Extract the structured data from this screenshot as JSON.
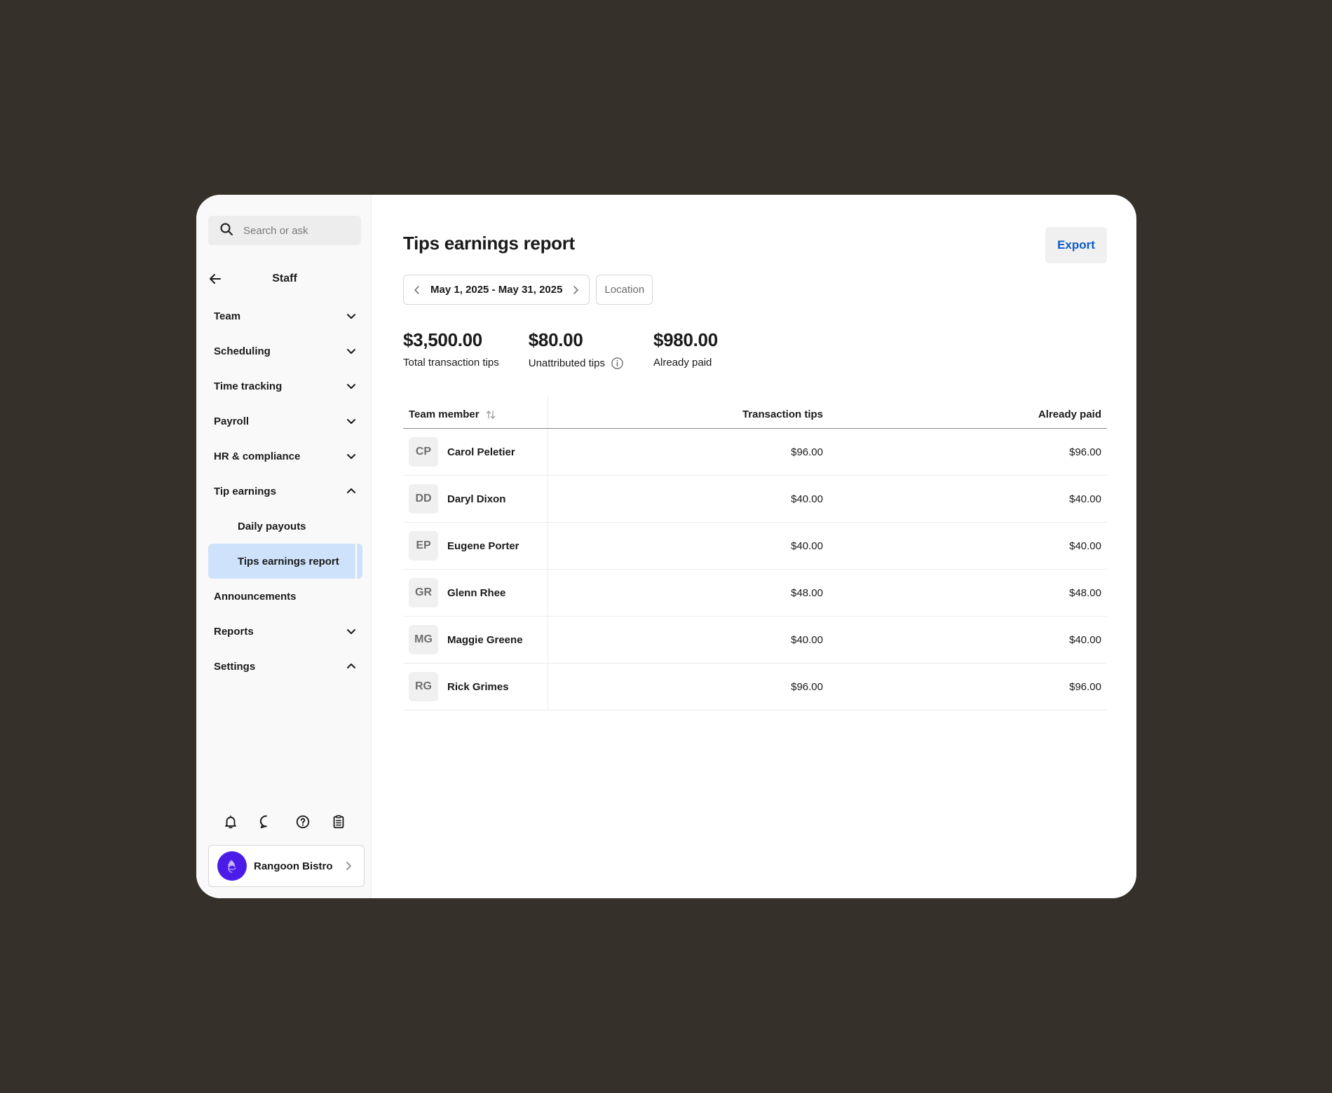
{
  "search": {
    "placeholder": "Search or ask"
  },
  "sidebar": {
    "title": "Staff",
    "items": [
      {
        "label": "Team",
        "chevron": "down"
      },
      {
        "label": "Scheduling",
        "chevron": "down"
      },
      {
        "label": "Time tracking",
        "chevron": "down"
      },
      {
        "label": "Payroll",
        "chevron": "down"
      },
      {
        "label": "HR & compliance",
        "chevron": "down"
      },
      {
        "label": "Tip earnings",
        "chevron": "up"
      },
      {
        "label": "Daily payouts",
        "sub": true
      },
      {
        "label": "Tips earnings report",
        "sub": true,
        "active": true
      },
      {
        "label": "Announcements"
      },
      {
        "label": "Reports",
        "chevron": "down"
      },
      {
        "label": "Settings",
        "chevron": "up"
      }
    ],
    "bottom_icons": [
      "bell-icon",
      "chat-icon",
      "help-icon",
      "clipboard-icon"
    ],
    "account": {
      "name": "Rangoon Bistro",
      "logo_color": "#4b1ce8"
    }
  },
  "page": {
    "title": "Tips earnings report",
    "export_label": "Export",
    "date_range": "May 1, 2025 - May 31, 2025",
    "location_label": "Location"
  },
  "stats": [
    {
      "value": "$3,500.00",
      "label": "Total transaction tips"
    },
    {
      "value": "$80.00",
      "label": "Unattributed tips",
      "info": true
    },
    {
      "value": "$980.00",
      "label": "Already paid"
    }
  ],
  "table": {
    "columns": [
      "Team member",
      "Transaction tips",
      "Already paid"
    ],
    "rows": [
      {
        "initials": "CP",
        "name": "Carol Peletier",
        "tips": "$96.00",
        "paid": "$96.00"
      },
      {
        "initials": "DD",
        "name": "Daryl Dixon",
        "tips": "$40.00",
        "paid": "$40.00"
      },
      {
        "initials": "EP",
        "name": "Eugene Porter",
        "tips": "$40.00",
        "paid": "$40.00"
      },
      {
        "initials": "GR",
        "name": "Glenn Rhee",
        "tips": "$48.00",
        "paid": "$48.00"
      },
      {
        "initials": "MG",
        "name": "Maggie Greene",
        "tips": "$40.00",
        "paid": "$40.00"
      },
      {
        "initials": "RG",
        "name": "Rick Grimes",
        "tips": "$96.00",
        "paid": "$96.00"
      }
    ]
  },
  "colors": {
    "accent": "#0a5bc8",
    "active_nav": "#cfe2fb",
    "background": "#35302a"
  }
}
